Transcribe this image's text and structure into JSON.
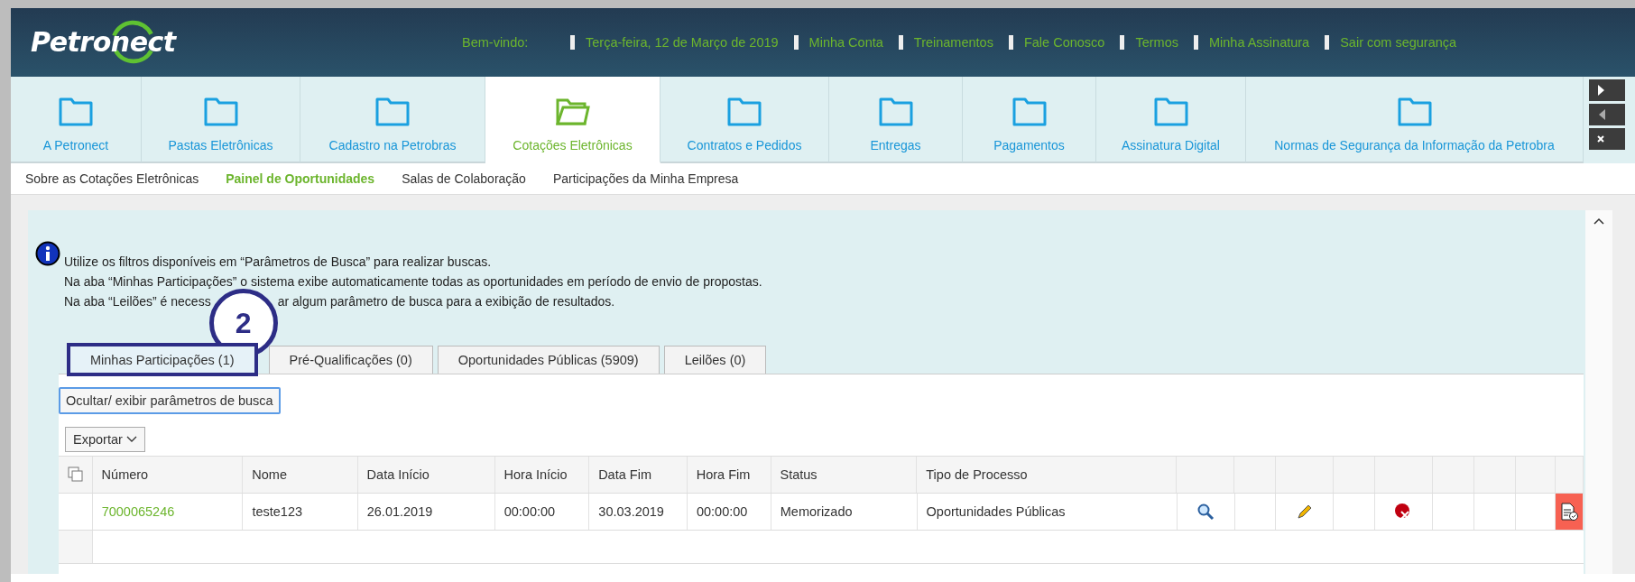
{
  "header": {
    "logo": "Petronect",
    "welcome": "Bem-vindo:",
    "links": [
      "Terça-feira, 12 de Março de 2019",
      "Minha Conta",
      "Treinamentos",
      "Fale Conosco",
      "Termos",
      "Minha Assinatura",
      "Sair com segurança"
    ]
  },
  "nav_tiles": [
    {
      "label": "A Petronect",
      "selected": false
    },
    {
      "label": "Pastas Eletrônicas",
      "selected": false
    },
    {
      "label": "Cadastro na Petrobras",
      "selected": false
    },
    {
      "label": "Cotações Eletrônicas",
      "selected": true
    },
    {
      "label": "Contratos e Pedidos",
      "selected": false
    },
    {
      "label": "Entregas",
      "selected": false
    },
    {
      "label": "Pagamentos",
      "selected": false
    },
    {
      "label": "Assinatura Digital",
      "selected": false
    },
    {
      "label": "Normas de Segurança da Informação da Petrobra",
      "selected": false
    }
  ],
  "sub_nav": [
    {
      "label": "Sobre as Cotações Eletrônicas",
      "selected": false
    },
    {
      "label": "Painel de Oportunidades",
      "selected": true
    },
    {
      "label": "Salas de Colaboração",
      "selected": false
    },
    {
      "label": "Participações da Minha Empresa",
      "selected": false
    }
  ],
  "info_lines": [
    "Utilize os filtros disponíveis em “Parâmetros de Busca” para realizar buscas.",
    "Na aba “Minhas Participações” o sistema exibe automaticamente todas as oportunidades em período de envio de propostas.",
    {
      "before": "Na aba “Leilões” é necess",
      "after": "ar algum parâmetro de busca para a exibição de resultados."
    }
  ],
  "callout": {
    "number": "2"
  },
  "tabs": [
    {
      "label": "Minhas Participações (1)",
      "selected": true
    },
    {
      "label": "Pré-Qualificações (0)",
      "selected": false
    },
    {
      "label": "Oportunidades Públicas (5909)",
      "selected": false
    },
    {
      "label": "Leilões (0)",
      "selected": false
    }
  ],
  "toggle_button": "Ocultar/ exibir parâmetros de busca",
  "export_button": "Exportar",
  "table": {
    "columns": [
      "Número",
      "Nome",
      "Data Início",
      "Hora Início",
      "Data Fim",
      "Hora Fim",
      "Status",
      "Tipo de Processo"
    ],
    "rows": [
      {
        "cells": [
          "7000065246",
          "teste123",
          "26.01.2019",
          "00:00:00",
          "30.03.2019",
          "00:00:00",
          "Memorizado",
          "Oportunidades Públicas"
        ]
      }
    ]
  }
}
